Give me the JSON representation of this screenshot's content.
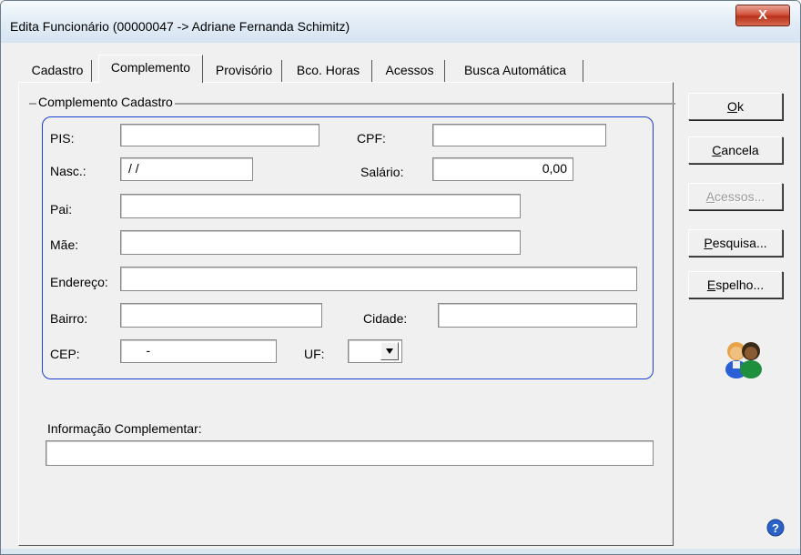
{
  "window": {
    "title": "Edita Funcionário (00000047 -> Adriane Fernanda Schimitz)",
    "close_label": "X"
  },
  "tabs": [
    {
      "label": "Cadastro"
    },
    {
      "label": "Complemento"
    },
    {
      "label": "Provisório"
    },
    {
      "label": "Bco. Horas"
    },
    {
      "label": "Acessos"
    },
    {
      "label": "Busca Automática"
    }
  ],
  "group": {
    "label": "Complemento Cadastro"
  },
  "form": {
    "pis_label": "PIS:",
    "pis_value": "",
    "cpf_label": "CPF:",
    "cpf_value": "",
    "nasc_label": "Nasc.:",
    "nasc_value": " / /",
    "salario_label": "Salário:",
    "salario_value": "0,00",
    "pai_label": "Pai:",
    "pai_value": "",
    "mae_label": "Mãe:",
    "mae_value": "",
    "endereco_label": "Endereço:",
    "endereco_value": "",
    "bairro_label": "Bairro:",
    "bairro_value": "",
    "cidade_label": "Cidade:",
    "cidade_value": "",
    "cep_label": "CEP:",
    "cep_value": "     -",
    "uf_label": "UF:",
    "uf_value": ""
  },
  "info": {
    "label": "Informação Complementar:",
    "value": ""
  },
  "buttons": {
    "ok": {
      "pre": "",
      "key": "O",
      "post": "k"
    },
    "cancela": {
      "pre": "",
      "key": "C",
      "post": "ancela"
    },
    "acessos": {
      "pre": "",
      "key": "A",
      "post": "cessos..."
    },
    "pesquisa": {
      "pre": "",
      "key": "P",
      "post": "esquisa..."
    },
    "espelho": {
      "pre": "",
      "key": "E",
      "post": "spelho..."
    }
  },
  "icons": {
    "users": "users-icon",
    "help": "help-icon",
    "dropdown": "chevron-down-icon"
  },
  "colors": {
    "group_border": "#1b3fcf",
    "close_button": "#c8432b"
  }
}
